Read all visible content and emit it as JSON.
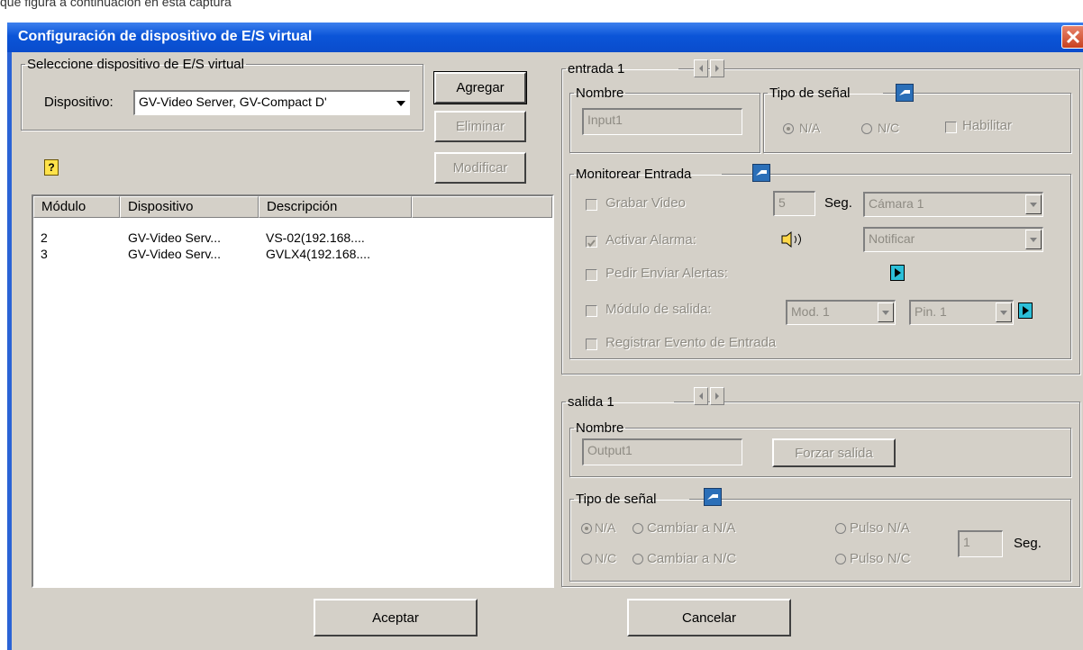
{
  "background_text": "que figura a continuación en esta captura",
  "window": {
    "title": "Configuración de dispositivo de E/S virtual"
  },
  "device_group": {
    "legend": "Seleccione dispositivo de E/S virtual",
    "device_label": "Dispositivo:",
    "device_value": "GV-Video Server, GV-Compact D'"
  },
  "buttons": {
    "add": "Agregar",
    "delete": "Eliminar",
    "modify": "Modificar",
    "accept": "Aceptar",
    "cancel": "Cancelar"
  },
  "help_icon": "?",
  "module_list": {
    "columns": [
      "Módulo",
      "Dispositivo",
      "Descripción"
    ],
    "rows": [
      {
        "module": "2",
        "device": "GV-Video Serv...",
        "description": "VS-02(192.168...."
      },
      {
        "module": "3",
        "device": "GV-Video Serv...",
        "description": "GVLX4(192.168...."
      }
    ]
  },
  "input_section": {
    "legend": "entrada 1",
    "name_legend": "Nombre",
    "name_value": "Input1",
    "signal_legend": "Tipo de señal",
    "signal_na": "N/A",
    "signal_nc": "N/C",
    "enable": "Habilitar",
    "monitor_legend": "Monitorear Entrada",
    "record_video": "Grabar Video",
    "record_seconds": "5",
    "seconds_unit": "Seg.",
    "camera": "Cámara 1",
    "activate_alarm": "Activar Alarma:",
    "alarm_mode": "Notificar",
    "request_alerts": "Pedir Enviar Alertas:",
    "output_module": "Módulo de salida:",
    "module_select": "Mod. 1",
    "pin_select": "Pin. 1",
    "log_event": "Registrar Evento de Entrada"
  },
  "output_section": {
    "legend": "salida 1",
    "name_legend": "Nombre",
    "name_value": "Output1",
    "force_output": "Forzar salida",
    "signal_legend": "Tipo de señal",
    "na": "N/A",
    "nc": "N/C",
    "switch_na": "Cambiar a N/A",
    "switch_nc": "Cambiar a N/C",
    "pulse_na": "Pulso N/A",
    "pulse_nc": "Pulso N/C",
    "pulse_seconds": "1",
    "seconds_unit": "Seg."
  },
  "colors": {
    "titlebar": "#0b55d8",
    "dialog_bg": "#d4d0c8",
    "icon_blue": "#2b6fb8",
    "icon_cyan": "#2cbfd8",
    "help_yellow": "#ffe24a"
  }
}
